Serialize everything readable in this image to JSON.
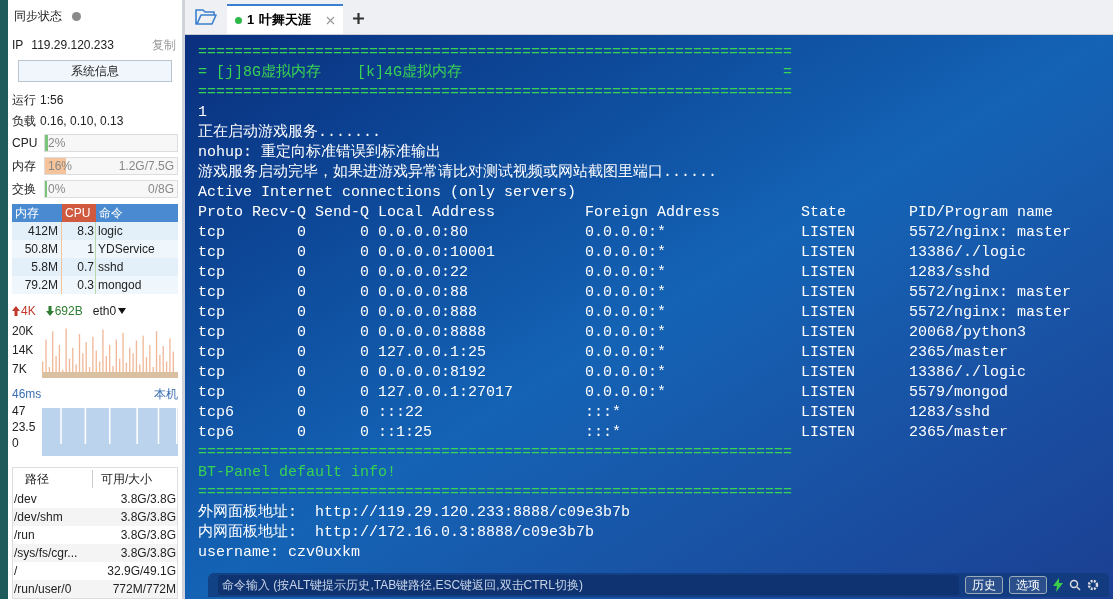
{
  "sidebar": {
    "sync": {
      "label": "同步状态",
      "online": false
    },
    "ip": {
      "label": "IP",
      "value": "119.29.120.233",
      "copy": "复制"
    },
    "sysinfo_button": "系统信息",
    "uptime": {
      "label": "运行",
      "value": "1:56"
    },
    "load": {
      "label": "负载",
      "value": "0.16, 0.10, 0.13"
    },
    "meters": [
      {
        "label": "CPU",
        "percent": "2%",
        "level": 0.02,
        "color": "#7cc47a"
      },
      {
        "label": "内存",
        "percent": "16%",
        "detail": "1.2G/7.5G",
        "level": 0.16,
        "color": "#f5c49a"
      },
      {
        "label": "交换",
        "percent": "0%",
        "detail": "0/8G",
        "level": 0,
        "color": "#7cc47a"
      }
    ],
    "processes": {
      "columns": [
        "内存",
        "CPU",
        "命令"
      ],
      "rows": [
        [
          "412M",
          "8.3",
          "logic"
        ],
        [
          "50.8M",
          "1",
          "YDService"
        ],
        [
          "5.8M",
          "0.7",
          "sshd"
        ],
        [
          "79.2M",
          "0.3",
          "mongod"
        ]
      ]
    },
    "network": {
      "up": "4K",
      "down": "692B",
      "interface": "eth0",
      "ticks": [
        "20K",
        "14K",
        "7K"
      ]
    },
    "ping": {
      "latency": "46ms",
      "host": "本机",
      "ticks": [
        "47",
        "23.5",
        "0"
      ]
    },
    "disks": {
      "columns": [
        "路径",
        "可用/大小"
      ],
      "rows": [
        [
          "/dev",
          "3.8G/3.8G"
        ],
        [
          "/dev/shm",
          "3.8G/3.8G"
        ],
        [
          "/run",
          "3.8G/3.8G"
        ],
        [
          "/sys/fs/cgr...",
          "3.8G/3.8G"
        ],
        [
          "/",
          "32.9G/49.1G"
        ],
        [
          "/run/user/0",
          "772M/772M"
        ]
      ]
    }
  },
  "tabs": [
    {
      "number": "1",
      "title": "叶舞天涯",
      "selected": true,
      "connected": true
    }
  ],
  "terminal": [
    {
      "kind": "rule",
      "text": "=================================================================="
    },
    {
      "kind": "menu",
      "left": "= [j]8G虚拟内存    [k]4G虚拟内存",
      "right": "="
    },
    {
      "kind": "rule",
      "text": "=================================================================="
    },
    {
      "kind": "text",
      "text": "1"
    },
    {
      "kind": "text",
      "text": "正在启动游戏服务......."
    },
    {
      "kind": "text",
      "text": "nohup: 重定向标准错误到标准输出"
    },
    {
      "kind": "text",
      "text": "游戏服务启动完毕，如果进游戏异常请比对测试视频或网站截图里端口......"
    },
    {
      "kind": "text",
      "text": "Active Internet connections (only servers)"
    },
    {
      "kind": "table",
      "columns": [
        "Proto",
        "Recv-Q",
        "Send-Q",
        "Local Address",
        "Foreign Address",
        "State",
        "PID/Program name"
      ],
      "rows": [
        [
          "tcp",
          "0",
          "0",
          "0.0.0.0:80",
          "0.0.0.0:*",
          "LISTEN",
          "5572/nginx: master"
        ],
        [
          "tcp",
          "0",
          "0",
          "0.0.0.0:10001",
          "0.0.0.0:*",
          "LISTEN",
          "13386/./logic"
        ],
        [
          "tcp",
          "0",
          "0",
          "0.0.0.0:22",
          "0.0.0.0:*",
          "LISTEN",
          "1283/sshd"
        ],
        [
          "tcp",
          "0",
          "0",
          "0.0.0.0:88",
          "0.0.0.0:*",
          "LISTEN",
          "5572/nginx: master"
        ],
        [
          "tcp",
          "0",
          "0",
          "0.0.0.0:888",
          "0.0.0.0:*",
          "LISTEN",
          "5572/nginx: master"
        ],
        [
          "tcp",
          "0",
          "0",
          "0.0.0.0:8888",
          "0.0.0.0:*",
          "LISTEN",
          "20068/python3"
        ],
        [
          "tcp",
          "0",
          "0",
          "127.0.0.1:25",
          "0.0.0.0:*",
          "LISTEN",
          "2365/master"
        ],
        [
          "tcp",
          "0",
          "0",
          "0.0.0.0:8192",
          "0.0.0.0:*",
          "LISTEN",
          "13386/./logic"
        ],
        [
          "tcp",
          "0",
          "0",
          "127.0.0.1:27017",
          "0.0.0.0:*",
          "LISTEN",
          "5579/mongod"
        ],
        [
          "tcp6",
          "0",
          "0",
          ":::22",
          ":::*",
          "LISTEN",
          "1283/sshd"
        ],
        [
          "tcp6",
          "0",
          "0",
          "::1:25",
          ":::*",
          "LISTEN",
          "2365/master"
        ]
      ]
    },
    {
      "kind": "rule",
      "text": "=================================================================="
    },
    {
      "kind": "heading",
      "text": "BT-Panel default info!"
    },
    {
      "kind": "rule",
      "text": "=================================================================="
    },
    {
      "kind": "text",
      "text": "外网面板地址:  http://119.29.120.233:8888/c09e3b7b"
    },
    {
      "kind": "text",
      "text": "内网面板地址:  http://172.16.0.3:8888/c09e3b7b"
    },
    {
      "kind": "text",
      "text": "username: czv0uxkm"
    }
  ],
  "command_bar": {
    "placeholder": "命令输入 (按ALT键提示历史,TAB键路径,ESC键返回,双击CTRL切换)",
    "buttons": [
      "历史",
      "选项"
    ]
  }
}
